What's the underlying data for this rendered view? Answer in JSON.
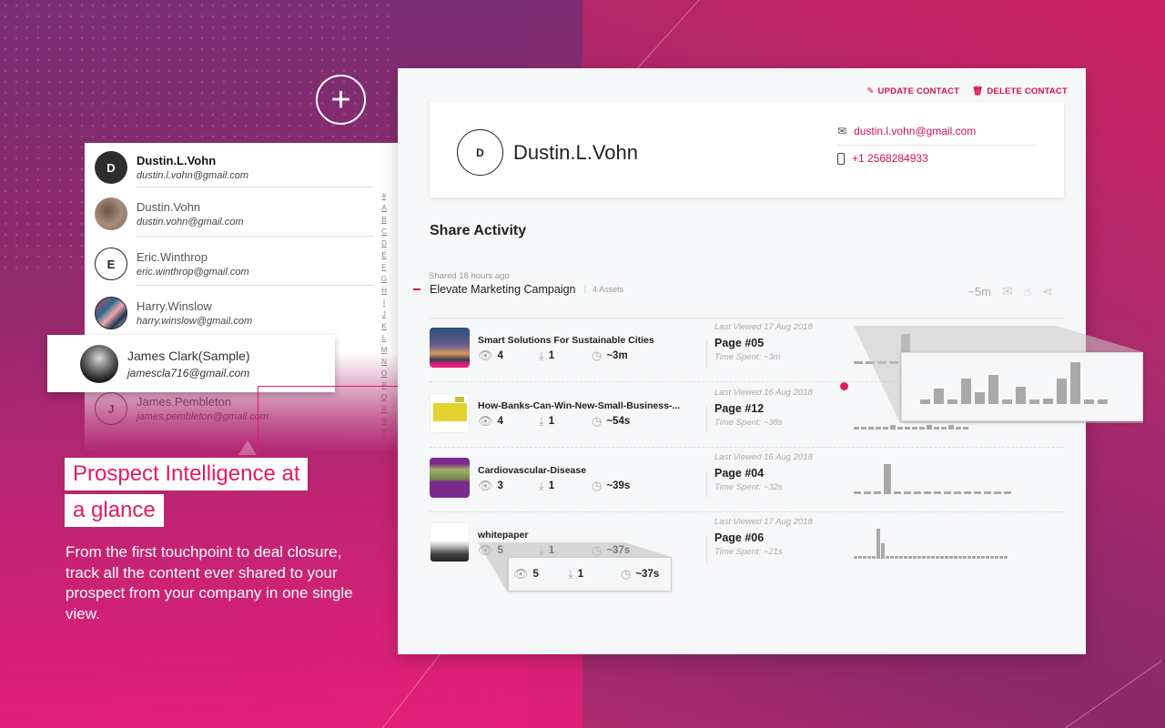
{
  "background": {
    "accent": "#e31c5f",
    "gradient_start": "#7a2d6e",
    "gradient_end": "#e0206f"
  },
  "add_button": {
    "icon": "plus-icon",
    "glyph": "+"
  },
  "contacts": {
    "items": [
      {
        "initial": "D",
        "name": "Dustin.L.Vohn",
        "email": "dustin.l.vohn@gmail.com",
        "avatar": "dark",
        "active": true
      },
      {
        "initial": "",
        "name": "Dustin.Vohn",
        "email": "dustin.vohn@gmail.com",
        "avatar": "photo"
      },
      {
        "initial": "E",
        "name": "Eric.Winthrop",
        "email": "eric.winthrop@gmail.com",
        "avatar": "outline"
      },
      {
        "initial": "",
        "name": "Harry.Winslow",
        "email": "harry.winslow@gmail.com",
        "avatar": "photo"
      },
      {
        "initial": "J",
        "name": "James.Pembleton",
        "email": "james.pembleton@gmail.com",
        "avatar": "outline"
      }
    ],
    "alphabet": [
      "#",
      "A",
      "B",
      "C",
      "D",
      "E",
      "F",
      "G",
      "H",
      "I",
      "J",
      "K",
      "L",
      "M",
      "N",
      "O",
      "P",
      "Q",
      "R",
      "S",
      "T"
    ],
    "highlighted": {
      "name": "James Clark(Sample)",
      "email": "jamescla716@gmail.com"
    }
  },
  "headline": {
    "line1": "Prospect Intelligence at",
    "line2": "a glance"
  },
  "body_text": "From the first touchpoint to deal closure, track all the content ever shared to your prospect from your company in one single view.",
  "main": {
    "actions": {
      "update": "UPDATE CONTACT",
      "delete": "DELETE CONTACT",
      "update_icon": "pencil-icon",
      "delete_icon": "trash-icon"
    },
    "contact": {
      "initial": "D",
      "name": "Dustin.L.Vohn",
      "email": "dustin.l.vohn@gmail.com",
      "phone": "+1 2568284933"
    },
    "share_activity_title": "Share Activity",
    "campaign": {
      "shared_ago": "Shared 18 hours ago",
      "name": "Elevate Marketing Campaign",
      "assets": "4 Assets",
      "duration": "~5m"
    },
    "assets": [
      {
        "title": "Smart Solutions For Sustainable Cities",
        "views": "4",
        "downloads": "1",
        "time": "~3m",
        "last_viewed": "Last Viewed 17 Aug 2018",
        "page": "Page #05",
        "time_spent": "Time Spent: ~3m",
        "spark": [
          0.1,
          0.1,
          0.1,
          0.1,
          1.0
        ]
      },
      {
        "title": "How-Banks-Can-Win-New-Small-Business-...",
        "views": "4",
        "downloads": "1",
        "time": "~54s",
        "last_viewed": "Last Viewed 16 Aug 2018",
        "page": "Page #12",
        "time_spent": "Time Spent: ~38s",
        "spark": [
          0.1,
          0.1,
          0.1,
          0.1,
          0.1,
          0.15,
          0.1,
          0.1,
          0.1,
          0.1,
          0.15,
          0.1,
          0.1,
          0.15,
          0.1,
          0.1
        ]
      },
      {
        "title": "Cardiovascular-Disease",
        "views": "3",
        "downloads": "1",
        "time": "~39s",
        "last_viewed": "Last Viewed 16 Aug 2018",
        "page": "Page #04",
        "time_spent": "Time Spent: ~32s",
        "spark": [
          0.1,
          0.1,
          0.1,
          1.0,
          0.1,
          0.1,
          0.1,
          0.1,
          0.1,
          0.1,
          0.1,
          0.1,
          0.1,
          0.1,
          0.1,
          0.1
        ]
      },
      {
        "title": "whitepaper",
        "views": "5",
        "downloads": "1",
        "time": "~37s",
        "last_viewed": "Last Viewed 17 Aug 2018",
        "page": "Page #06",
        "time_spent": "Time Spent: ~21s",
        "spark": [
          0.1,
          0.1,
          0.1,
          0.1,
          0.1,
          1.0,
          0.5,
          0.1,
          0.1,
          0.1,
          0.1,
          0.1,
          0.1,
          0.1,
          0.1,
          0.1,
          0.1,
          0.1,
          0.1,
          0.1,
          0.1,
          0.1,
          0.1,
          0.1,
          0.1,
          0.1,
          0.1,
          0.1,
          0.1,
          0.1,
          0.1,
          0.1,
          0.1,
          0.1
        ]
      }
    ],
    "zoomed_spark": [
      0.1,
      0.38,
      0.1,
      0.6,
      0.28,
      0.7,
      0.1,
      0.42,
      0.1,
      0.12,
      0.6,
      1.0,
      0.1,
      0.1
    ],
    "zoomed_stats": {
      "views": "5",
      "downloads": "1",
      "time": "~37s"
    }
  }
}
